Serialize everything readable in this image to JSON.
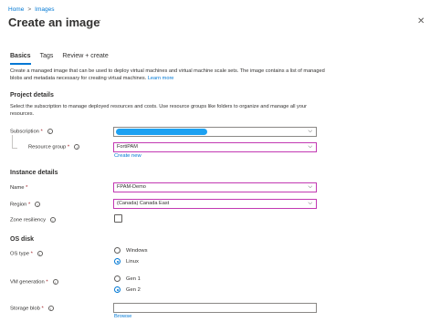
{
  "breadcrumb": {
    "home": "Home",
    "sep": ">",
    "images": "Images"
  },
  "page": {
    "title": "Create an image",
    "more": "···",
    "close": "✕"
  },
  "tabs": [
    {
      "label": "Basics"
    },
    {
      "label": "Tags"
    },
    {
      "label": "Review + create"
    }
  ],
  "description": {
    "text": "Create a managed image that can be used to deploy virtual machines and virtual machine scale sets. The image contains a list of managed blobs and metadata necessary for creating virtual machines.",
    "link": "Learn more"
  },
  "project": {
    "heading": "Project details",
    "text": "Select the subscription to manage deployed resources and costs. Use resource groups like folders to organize and manage all your resources.",
    "subscription_label": "Subscription",
    "resource_group_label": "Resource group",
    "resource_group_value": "FortiPAM",
    "create_new": "Create new"
  },
  "instance": {
    "heading": "Instance details",
    "name_label": "Name",
    "name_value": "FPAM-Demo",
    "region_label": "Region",
    "region_value": "(Canada) Canada East",
    "zone_label": "Zone resiliency"
  },
  "os": {
    "heading": "OS disk",
    "os_type_label": "OS type",
    "os_windows": "Windows",
    "os_linux": "Linux",
    "vm_gen_label": "VM generation",
    "gen1": "Gen 1",
    "gen2": "Gen 2",
    "blob_label": "Storage blob",
    "browse": "Browse"
  },
  "symbols": {
    "required": "*",
    "info": "i",
    "chevron": "⌵"
  },
  "colors": {
    "accent": "#0078d4",
    "focus_border": "#c239b3",
    "redaction": "#1da1f2",
    "required": "#a4262c"
  }
}
